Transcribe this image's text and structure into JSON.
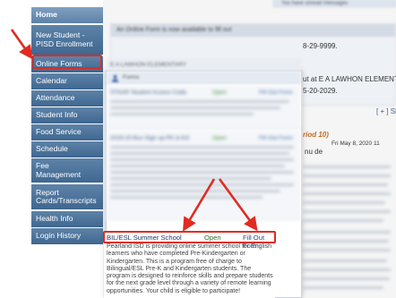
{
  "sidebar": {
    "items": [
      {
        "label": "Home"
      },
      {
        "label": "New Student -\nPISD Enrollment"
      },
      {
        "label": "Online Forms"
      },
      {
        "label": "Calendar"
      },
      {
        "label": "Attendance"
      },
      {
        "label": "Student Info"
      },
      {
        "label": "Food Service"
      },
      {
        "label": "Schedule"
      },
      {
        "label": "Fee\nManagement"
      },
      {
        "label": "Report\nCards/Transcripts"
      },
      {
        "label": "Health Info"
      },
      {
        "label": "Login History"
      }
    ]
  },
  "header": {
    "top_notice": "You have unread messages"
  },
  "background": {
    "announcement_title": "An Online Form is now available to fill out",
    "right_lines": [
      "8-29-9999.",
      "ut at E A LAWHON ELEMENT",
      "5-20-2029.",
      "[ + ] Sh",
      "riod 10)",
      "Fri May 8, 2020 11",
      "nu de"
    ]
  },
  "forms_panel": {
    "header_label": "Forms",
    "school_label": "E A LAWHON ELEMENTARY",
    "rows": [
      {
        "title": "STAAR Student Access Code",
        "status": "Open",
        "link": "Fill Out Form"
      },
      {
        "title": "2019-20 Bus Sign up PK & KG",
        "status": "Open",
        "link": "Fill Out Form"
      }
    ]
  },
  "summer_form": {
    "title": "BIL/ESL Summer School",
    "status": "Open",
    "link": "Fill Out Form",
    "description": "Pearland ISD is providing online summer school for English learners who have completed Pre-Kindergarten or Kindergarten. This is a program free of charge to Bilingual/ESL Pre-K and Kindergarten students. The program is designed to reinforce skills and prepare students for the next grade level through a variety of remote learning opportunities. Your child is eligible to participate!"
  },
  "colors": {
    "nav_bg": "#4a7099",
    "annotation": "#e02b22",
    "link": "#1e4d8e",
    "open_status": "#2c6f2c"
  }
}
